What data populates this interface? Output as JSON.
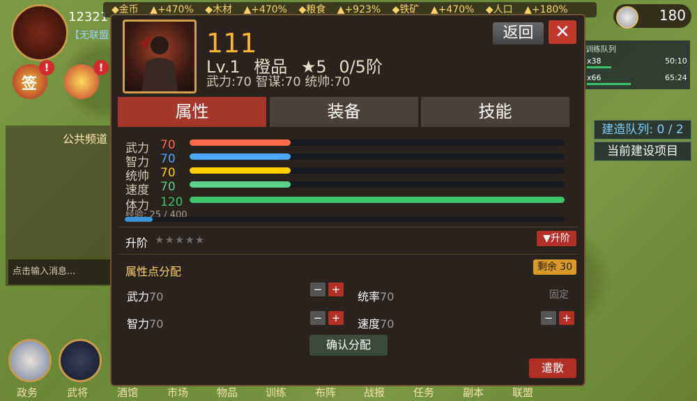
{
  "player": {
    "name": "12321",
    "alliance": "【无联盟"
  },
  "resources": [
    "◆金币",
    "▲+470%",
    "◆木材",
    "▲+470%",
    "◆粮食",
    "▲+923%",
    "◆铁矿",
    "▲+470%",
    "◆人口",
    "▲+180%"
  ],
  "gold": {
    "value": "180"
  },
  "training": {
    "title": "训练队列",
    "rows": [
      {
        "label": "x38",
        "time": "50:10"
      },
      {
        "label": "x66",
        "time": "65:24"
      }
    ],
    "progress": [
      0.25,
      0.45
    ]
  },
  "build_queue": {
    "label": "建造队列: 0 / 2"
  },
  "current_build": {
    "label": "当前建设项目"
  },
  "events": {
    "badge1": "!",
    "badge2": "!",
    "event1_text": "签"
  },
  "chat": {
    "title": "公共频道",
    "placeholder": "点击输入消息..."
  },
  "bottom_nav": [
    "政务",
    "武将",
    "酒馆",
    "市场",
    "物品",
    "训练",
    "布阵",
    "战报",
    "任务",
    "副本",
    "联盟"
  ],
  "hero": {
    "name": "111",
    "level": "Lv.1",
    "quality": "橙品",
    "stars": "★5",
    "tier": "0/5阶",
    "summary": "武力:70  智谋:70  统帅:70"
  },
  "buttons": {
    "back": "返回",
    "close": "✕",
    "confirm": "确认分配",
    "dismiss": "遣散",
    "ascend": "▼升阶"
  },
  "tabs": [
    "属性",
    "装备",
    "技能"
  ],
  "stats": [
    {
      "label": "武力",
      "value": "70",
      "color": "#ff6b4a",
      "fill": 0.27
    },
    {
      "label": "智力",
      "value": "70",
      "color": "#4aa8ff",
      "fill": 0.27
    },
    {
      "label": "统帅",
      "value": "70",
      "color": "#ffd000",
      "fill": 0.27
    },
    {
      "label": "速度",
      "value": "70",
      "color": "#5bd28a",
      "fill": 0.27
    },
    {
      "label": "体力",
      "value": "120",
      "color": "#3ec46d",
      "fill": 1.0
    }
  ],
  "exp": {
    "label": "经验: 25 / 400",
    "fill": 0.0625
  },
  "ascend": {
    "title": "升阶",
    "stars": "★★★★★"
  },
  "allocation": {
    "title": "属性点分配",
    "remaining": "剩余 30",
    "items": [
      {
        "label": "武力",
        "value": "70"
      },
      {
        "label": "统率",
        "value": "70"
      },
      {
        "label": "智力",
        "value": "70"
      },
      {
        "label": "速度",
        "value": "70"
      }
    ],
    "fixed": "固定"
  }
}
